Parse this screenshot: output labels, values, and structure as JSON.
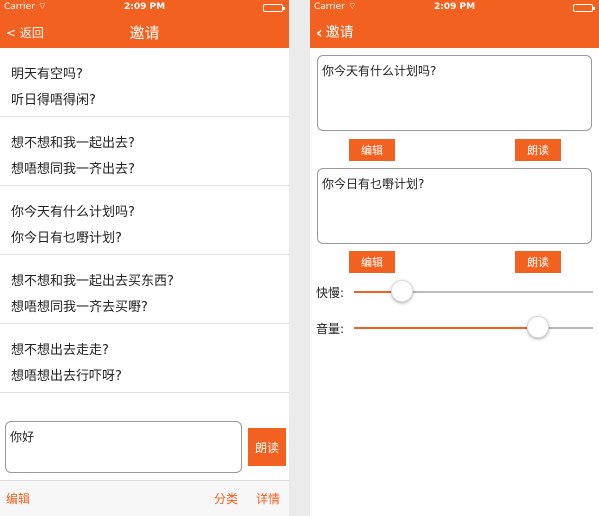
{
  "status_bar": {
    "carrier": "Carrier",
    "time": "2:09 PM"
  },
  "left": {
    "nav": {
      "back_label": "< 返回",
      "title": "邀请"
    },
    "phrases": [
      {
        "mandarin": "明天有空吗?",
        "cantonese": "听日得唔得闲?"
      },
      {
        "mandarin": "想不想和我一起出去?",
        "cantonese": "想唔想同我一齐出去?"
      },
      {
        "mandarin": "你今天有什么计划吗?",
        "cantonese": "你今日有乜嘢计划?"
      },
      {
        "mandarin": "想不想和我一起出去买东西?",
        "cantonese": "想唔想同我一齐去买嘢?"
      },
      {
        "mandarin": "想不想出去走走?",
        "cantonese": "想唔想出去行吓呀?"
      }
    ],
    "input_value": "你好",
    "read_button": "朗读",
    "toolbar": {
      "edit": "编辑",
      "category": "分类",
      "details": "详情"
    }
  },
  "right": {
    "nav": {
      "back_label": "邀请"
    },
    "mandarin_text": "你今天有什么计划吗?",
    "cantonese_text": "你今日有乜嘢计划?",
    "edit_button": "编辑",
    "read_button": "朗读",
    "speed": {
      "label": "快慢:",
      "value": 0.2
    },
    "volume": {
      "label": "音量:",
      "value": 0.77
    }
  },
  "colors": {
    "accent": "#f2611f"
  },
  "icons": {
    "wifi": "wifi-icon",
    "battery": "battery-icon",
    "back": "chevron-left-icon"
  }
}
